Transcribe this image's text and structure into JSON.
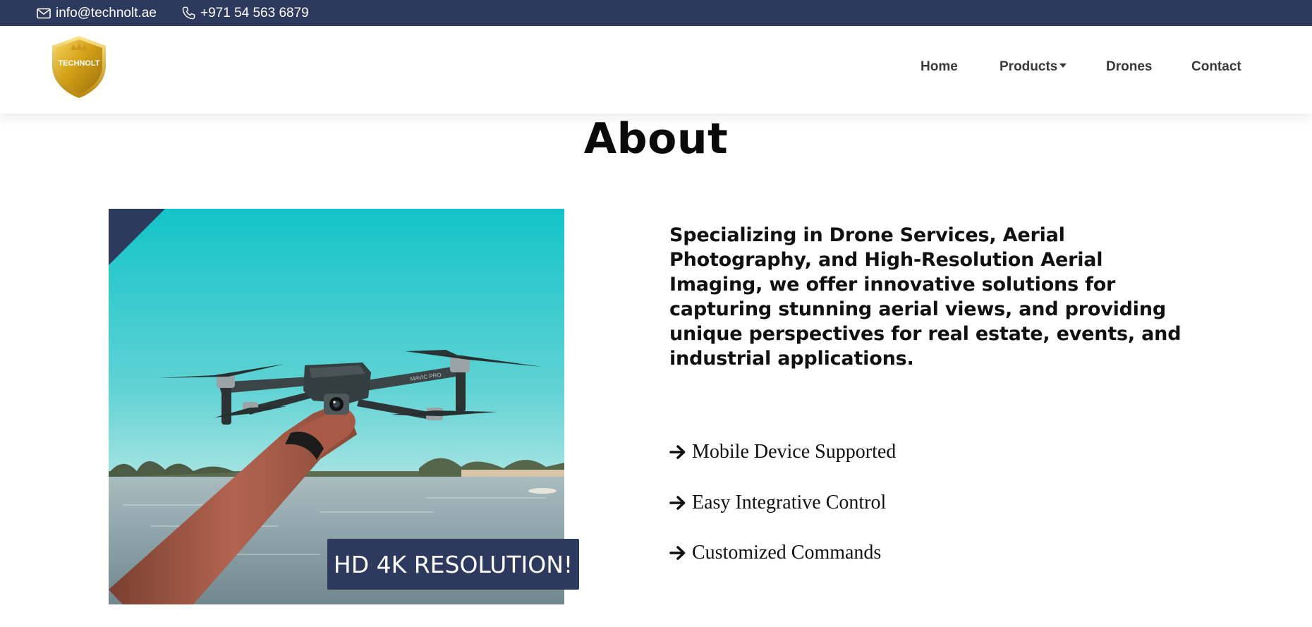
{
  "topbar": {
    "email": "info@technolt.ae",
    "phone": "+971 54 563 6879",
    "email_icon": "envelope-icon",
    "phone_icon": "phone-icon",
    "background": "#2d3a5e"
  },
  "nav": {
    "logo_text": "TECHNOLT",
    "items": [
      {
        "label": "Home"
      },
      {
        "label": "Products"
      },
      {
        "label": "Drones"
      },
      {
        "label": "Contact"
      }
    ]
  },
  "about": {
    "title": "About",
    "badge": "HD 4K RESOLUTION!",
    "description": "Specializing in Drone Services, Aerial Photography, and High-Resolution Aerial Imaging, we offer innovative solutions for capturing stunning aerial views, and providing unique perspectives for real estate, events, and industrial applications.",
    "features": [
      {
        "label": "Mobile Device Supported",
        "icon": "arrow-right-icon"
      },
      {
        "label": "Easy Integrative Control",
        "icon": "arrow-right-icon"
      },
      {
        "label": "Customized Commands",
        "icon": "arrow-right-icon"
      }
    ],
    "image_label": "drone-photo",
    "drone_brand_text": "MAVIC PRO"
  },
  "colors": {
    "accent": "#2d3a5e",
    "gold": "#d4a017"
  }
}
